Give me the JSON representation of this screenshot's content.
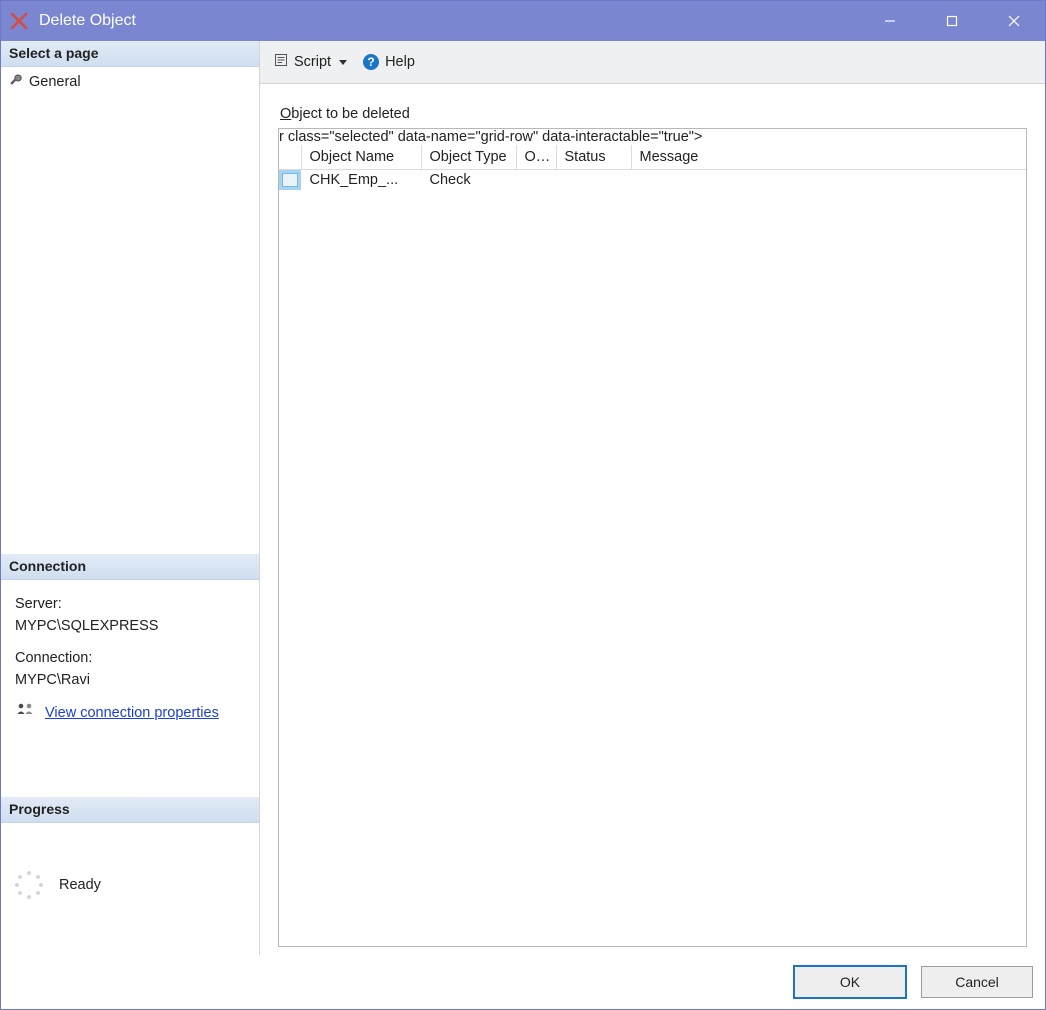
{
  "window": {
    "title": "Delete Object"
  },
  "sidebar": {
    "select_page_header": "Select a page",
    "pages": [
      {
        "label": "General"
      }
    ],
    "connection_header": "Connection",
    "server_label": "Server:",
    "server_value": "MYPC\\SQLEXPRESS",
    "connection_label": "Connection:",
    "connection_value": "MYPC\\Ravi",
    "view_connection_props": "View connection properties",
    "progress_header": "Progress",
    "progress_status": "Ready"
  },
  "toolbar": {
    "script_label": "Script",
    "help_label": "Help"
  },
  "main": {
    "group_label_prefix": "O",
    "group_label_rest": "bject to be deleted",
    "columns": {
      "object_name": "Object Name",
      "object_type": "Object Type",
      "owner": "O...",
      "status": "Status",
      "message": "Message"
    },
    "rows": [
      {
        "object_name": "CHK_Emp_...",
        "object_type": "Check",
        "owner": "",
        "status": "",
        "message": ""
      }
    ]
  },
  "footer": {
    "ok": "OK",
    "cancel": "Cancel"
  }
}
